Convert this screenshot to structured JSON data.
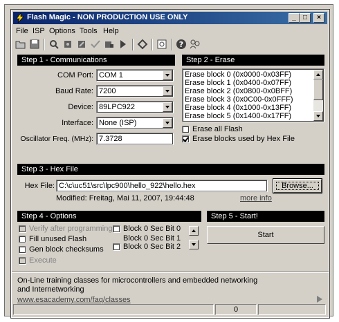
{
  "window": {
    "title": "Flash Magic - NON PRODUCTION USE ONLY",
    "minimize": "_",
    "maximize": "□",
    "close": "×"
  },
  "menu": [
    "File",
    "ISP",
    "Options",
    "Tools",
    "Help"
  ],
  "toolbar": [
    "open-icon",
    "save-icon",
    "search-icon",
    "chip-blank-icon",
    "chip-erase-icon",
    "verify-check-icon",
    "program-icon",
    "go-arrow-icon",
    "jump-icon",
    "hex-view-icon",
    "help-icon",
    "users-icon"
  ],
  "step1": {
    "heading": "Step 1 - Communications",
    "com_port_label": "COM Port:",
    "com_port_value": "COM 1",
    "baud_label": "Baud Rate:",
    "baud_value": "7200",
    "device_label": "Device:",
    "device_value": "89LPC922",
    "interface_label": "Interface:",
    "interface_value": "None (ISP)",
    "osc_label": "Oscillator Freq. (MHz):",
    "osc_value": "7.3728"
  },
  "step2": {
    "heading": "Step 2 - Erase",
    "blocks": [
      "Erase block 0 (0x0000-0x03FF)",
      "Erase block 1 (0x0400-0x07FF)",
      "Erase block 2 (0x0800-0x0BFF)",
      "Erase block 3 (0x0C00-0x0FFF)",
      "Erase block 4 (0x1000-0x13FF)",
      "Erase block 5 (0x1400-0x17FF)"
    ],
    "erase_all": "Erase all Flash",
    "erase_used": "Erase blocks used by Hex File"
  },
  "step3": {
    "heading": "Step 3 - Hex File",
    "hex_label": "Hex File:",
    "hex_value": "C:\\c\\uc51\\src\\lpc900\\hello_922\\hello.hex",
    "browse": "Browse...",
    "modified": "Modified: Freitag, Mai 11, 2007, 19:44:48",
    "more_info": "more info"
  },
  "step4": {
    "heading": "Step 4 - Options",
    "verify": "Verify after programming",
    "fill": "Fill unused Flash",
    "gen": "Gen block checksums",
    "execute": "Execute",
    "b0": "Block 0 Sec Bit 0",
    "b1": "Block 0 Sec Bit 1",
    "b2": "Block 0 Sec Bit 2"
  },
  "step5": {
    "heading": "Step 5 - Start!",
    "start": "Start"
  },
  "info": {
    "text": "On-Line training classes for microcontrollers and embedded networking and Internetworking",
    "link": "www.esacademy.com/faq/classes"
  },
  "status": {
    "count": "0"
  },
  "colors": {
    "face": "#d4d0c8",
    "title_start": "#0a246a",
    "title_end": "#3a6ea5",
    "step_bar": "#000000"
  }
}
